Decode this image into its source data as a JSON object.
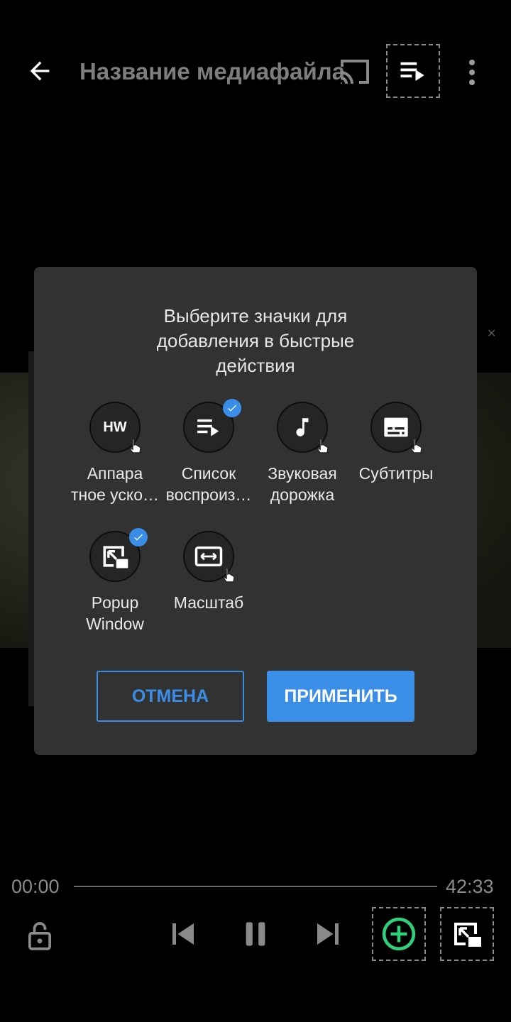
{
  "header": {
    "title": "Название медиафайла",
    "back_icon": "arrow-left-icon",
    "cast_icon": "cast-icon",
    "playlist_icon": "playlist-play-icon",
    "more_icon": "more-vert-icon"
  },
  "dialog": {
    "title_lines": [
      "Выберите значки для",
      "добавления в быстрые",
      "действия"
    ],
    "options": [
      {
        "icon": "hw-acceleration-icon",
        "label_lines": [
          "Аппара",
          "тное уско…"
        ],
        "checked": false
      },
      {
        "icon": "playlist-icon",
        "label_lines": [
          "Список",
          "воспроиз…"
        ],
        "checked": true
      },
      {
        "icon": "music-note-icon",
        "label_lines": [
          "Звуковая",
          "дорожка"
        ],
        "checked": false
      },
      {
        "icon": "subtitles-icon",
        "label_lines": [
          "Субтитры"
        ],
        "checked": false
      },
      {
        "icon": "popup-window-icon",
        "label_lines": [
          "Popup",
          "Window"
        ],
        "checked": true
      },
      {
        "icon": "aspect-ratio-icon",
        "label_lines": [
          "Масштаб"
        ],
        "checked": false
      }
    ],
    "hw_text": "HW",
    "cancel_label": "ОТМЕНА",
    "apply_label": "ПРИМЕНИТЬ"
  },
  "player": {
    "current_time": "00:00",
    "total_time": "42:33",
    "progress": 0
  },
  "controls": {
    "lock_icon": "lock-icon",
    "prev_icon": "skip-previous-icon",
    "pause_icon": "pause-icon",
    "next_icon": "skip-next-icon",
    "add_icon": "add-circle-icon",
    "popup_icon": "popup-window-icon"
  },
  "colors": {
    "accent": "#3a8ee8",
    "add_green": "#2fd07a",
    "dialog_bg": "#323232"
  }
}
